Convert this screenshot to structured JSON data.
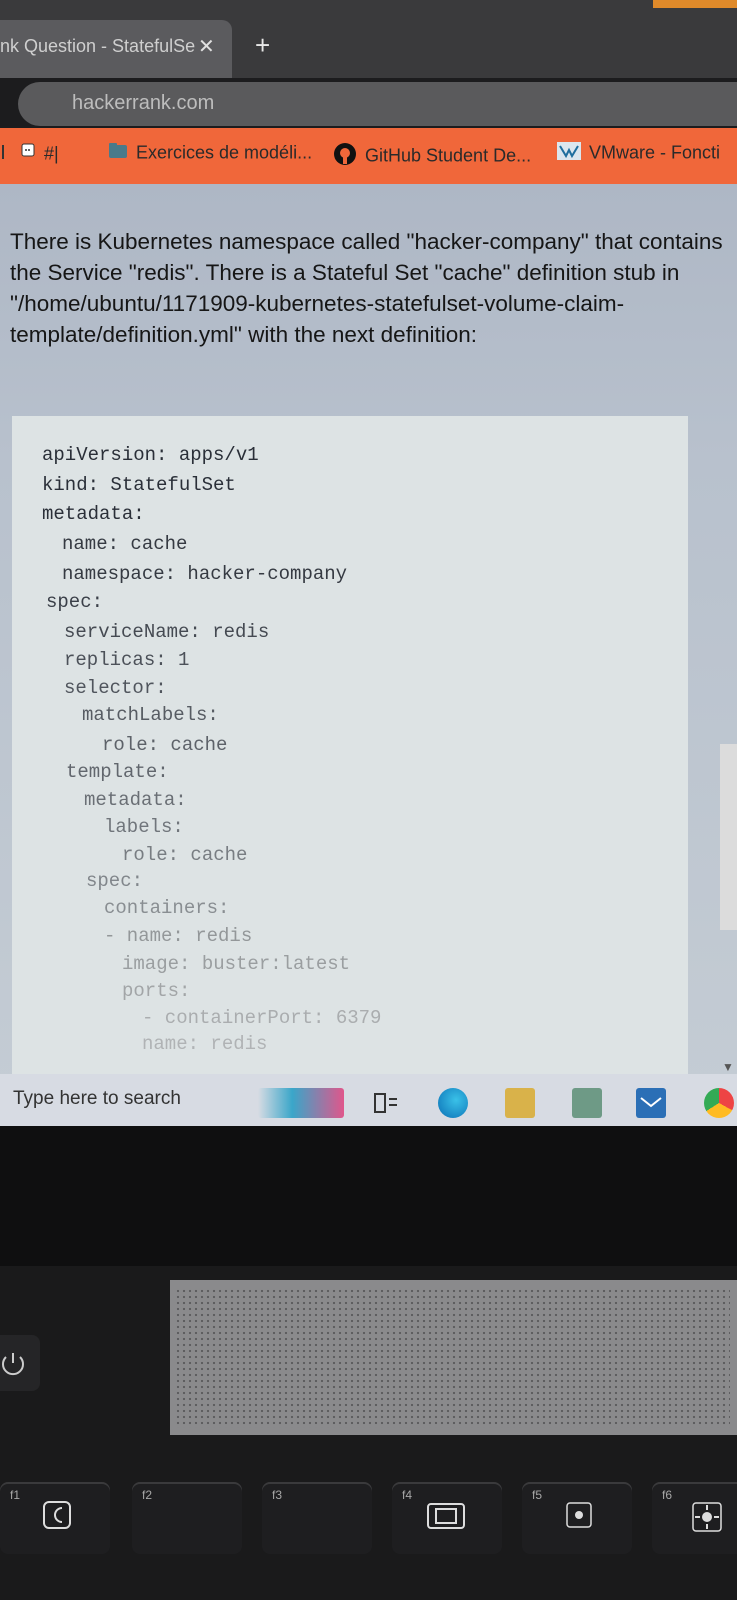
{
  "browser": {
    "tab_title": "nk Question - StatefulSe",
    "tab_close": "✕",
    "new_tab": "+",
    "url": "hackerrank.com",
    "bookmarks": [
      {
        "label": "#|",
        "icon": "bookmark-app-icon"
      },
      {
        "label": "Exercices de modéli...",
        "icon": "folder-icon"
      },
      {
        "label": "GitHub Student De...",
        "icon": "github-icon"
      },
      {
        "label": "VMware - Foncti",
        "icon": "vmware-icon"
      }
    ]
  },
  "question": {
    "text": "There is Kubernetes namespace called \"hacker-company\" that contains the Service \"redis\". There is a Stateful Set \"cache\" definition stub in \"/home/ubuntu/1171909-kubernetes-statefulset-volume-claim-template/definition.yml\" with the next definition:"
  },
  "code": {
    "lines": [
      "apiVersion: apps/v1",
      "kind: StatefulSet",
      "metadata:",
      "  name: cache",
      "  namespace: hacker-company",
      "spec:",
      "  serviceName: redis",
      "  replicas: 1",
      "  selector:",
      "    matchLabels:",
      "      role: cache",
      "  template:",
      "    metadata:",
      "      labels:",
      "        role: cache",
      "    spec:",
      "      containers:",
      "      - name: redis",
      "        image: buster:latest",
      "        ports:",
      "        - containerPort: 6379",
      "          name: redis"
    ]
  },
  "taskbar": {
    "search_placeholder": "Type here to search",
    "icons": [
      "widget-icon",
      "task-view-icon",
      "edge-icon",
      "file-explorer-icon",
      "store-icon",
      "mail-icon",
      "chrome-icon"
    ]
  },
  "keyboard": {
    "keys": [
      "f1",
      "f2",
      "f3",
      "f4",
      "f5",
      "f6"
    ]
  }
}
